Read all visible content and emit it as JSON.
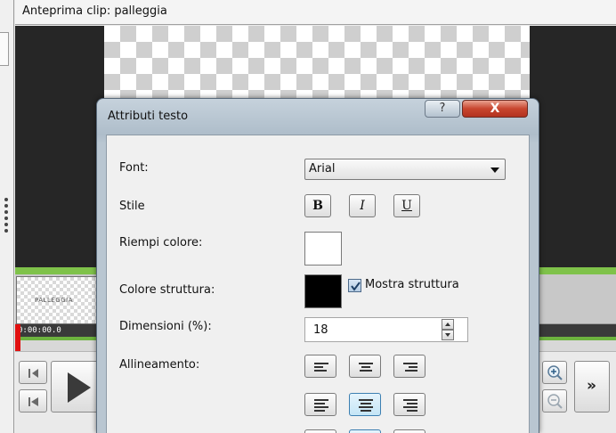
{
  "preview": {
    "title": "Anteprima clip: palleggia",
    "clip_name": "PALLEGGIA",
    "time": "0:00:00.0"
  },
  "controls": {
    "step_back_icon": "step-back-icon",
    "go_start_icon": "go-to-start-icon",
    "play_icon": "play-icon",
    "zoom_in_icon": "zoom-in-icon",
    "zoom_out_icon": "zoom-out-icon",
    "more_label": "»"
  },
  "dialog": {
    "title": "Attributi testo",
    "help_label": "?",
    "close_label": "X",
    "font_label": "Font:",
    "font_value": "Arial",
    "style_label": "Stile",
    "bold_label": "B",
    "italic_label": "I",
    "underline_label": "U",
    "fill_label": "Riempi colore:",
    "fill_color": "#ffffff",
    "outline_color_label": "Colore struttura:",
    "outline_color": "#000000",
    "show_outline_label": "Mostra struttura",
    "show_outline_checked": true,
    "size_label": "Dimensioni (%):",
    "size_value": "18",
    "align_label": "Allineamento:",
    "selected_alignment": "center"
  },
  "colors": {
    "timeline_green": "#7fc24a",
    "playhead_red": "#e01010",
    "close_red": "#c8462f",
    "selection_blue": "#3c7fb1"
  }
}
